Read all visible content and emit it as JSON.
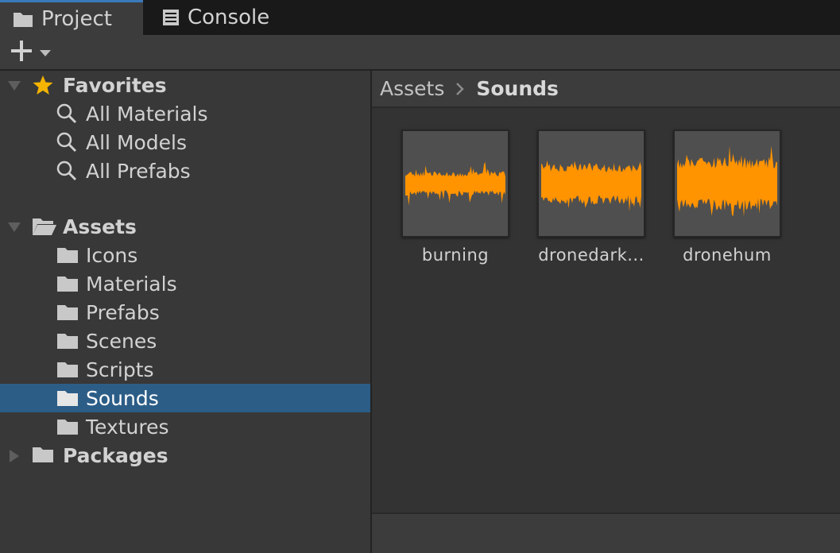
{
  "tabs": [
    {
      "label": "Project",
      "icon": "folder-icon"
    },
    {
      "label": "Console",
      "icon": "console-icon"
    }
  ],
  "toolbar": {
    "create_icon": "plus-icon"
  },
  "favorites": {
    "label": "Favorites",
    "items": [
      {
        "label": "All Materials"
      },
      {
        "label": "All Models"
      },
      {
        "label": "All Prefabs"
      }
    ]
  },
  "assets": {
    "label": "Assets",
    "folders": [
      {
        "label": "Icons"
      },
      {
        "label": "Materials"
      },
      {
        "label": "Prefabs"
      },
      {
        "label": "Scenes"
      },
      {
        "label": "Scripts"
      },
      {
        "label": "Sounds",
        "selected": true
      },
      {
        "label": "Textures"
      }
    ]
  },
  "packages": {
    "label": "Packages"
  },
  "breadcrumb": {
    "root": "Assets",
    "current": "Sounds"
  },
  "files": [
    {
      "name": "burning"
    },
    {
      "name": "dronedark..."
    },
    {
      "name": "dronehum"
    }
  ],
  "colors": {
    "accent": "#3a79bb",
    "selection": "#2c5d87",
    "waveform": "#ff9300",
    "star": "#f4b400"
  }
}
